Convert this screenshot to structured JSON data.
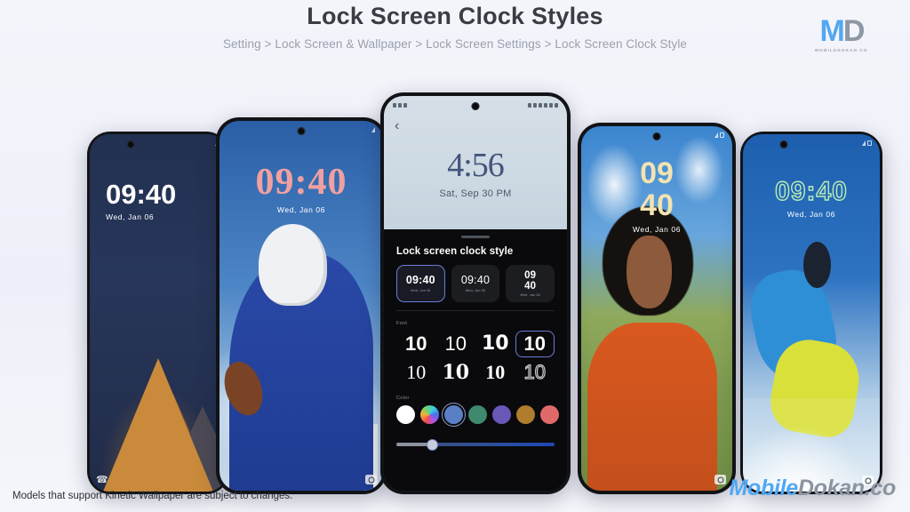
{
  "header": {
    "title": "Lock Screen Clock Styles",
    "breadcrumb": "Setting > Lock Screen & Wallpaper > Lock Screen Settings > Lock Screen Clock Style"
  },
  "logo": {
    "mark_m": "M",
    "mark_d": "D",
    "subtitle": "MOBILEDOKAN.CO"
  },
  "footer": {
    "note": "Models that support Kinetic Wallpaper are subject to changes.",
    "watermark_a": "Mobile",
    "watermark_b": "Dokan.co"
  },
  "phones": [
    {
      "name": "mountain",
      "time": "09:40",
      "date": "Wed,  Jan 06",
      "time_color": "#ffffff"
    },
    {
      "name": "quarterback",
      "time": "09:40",
      "date": "Wed,  Jan 06",
      "time_color": "#f0a0a0"
    },
    {
      "name": "woman",
      "time_line1": "09",
      "time_line2": "40",
      "date": "Wed, Jan 06",
      "time_color": "#f2e3b0"
    },
    {
      "name": "snowboarder",
      "time": "09:40",
      "date": "Wed,  Jan 06",
      "time_color": "#b9edb4"
    }
  ],
  "center_phone": {
    "preview": {
      "back_icon": "‹",
      "clock": "4:56",
      "date": "Sat, Sep 30  PM"
    },
    "sheet": {
      "title": "Lock screen clock style",
      "styles": [
        {
          "time": "09:40",
          "date": "Wed, Jan 06",
          "selected": true,
          "variant": "bold"
        },
        {
          "time": "09:40",
          "date": "Wed, Jan 06",
          "selected": false,
          "variant": "thin"
        },
        {
          "time_line1": "09",
          "time_line2": "40",
          "date": "Wed, Jan 06",
          "selected": false,
          "variant": "stack"
        }
      ],
      "font_label": "Font",
      "fonts": [
        {
          "sample": "10",
          "selected": false
        },
        {
          "sample": "10",
          "selected": false
        },
        {
          "sample": "10",
          "selected": false
        },
        {
          "sample": "10",
          "selected": true
        },
        {
          "sample": "10",
          "selected": false
        },
        {
          "sample": "10",
          "selected": false
        },
        {
          "sample": "10",
          "selected": false
        },
        {
          "sample": "10",
          "selected": false
        }
      ],
      "color_label": "Color",
      "colors": [
        {
          "name": "white",
          "hex": "#ffffff",
          "selected": false
        },
        {
          "name": "rainbow",
          "hex": "rainbow",
          "selected": false
        },
        {
          "name": "blue",
          "hex": "#5a7fc4",
          "selected": true
        },
        {
          "name": "green",
          "hex": "#3f8a6e",
          "selected": false
        },
        {
          "name": "purple",
          "hex": "#6a57b8",
          "selected": false
        },
        {
          "name": "brown",
          "hex": "#b07c2e",
          "selected": false
        },
        {
          "name": "salmon",
          "hex": "#e06a6a",
          "selected": false
        }
      ],
      "slider": {
        "value_percent": 22
      }
    }
  },
  "theme": {
    "background": "#f2f3fa",
    "accent": "#6b7dd6",
    "sheet_bg": "#0a0a0c"
  }
}
